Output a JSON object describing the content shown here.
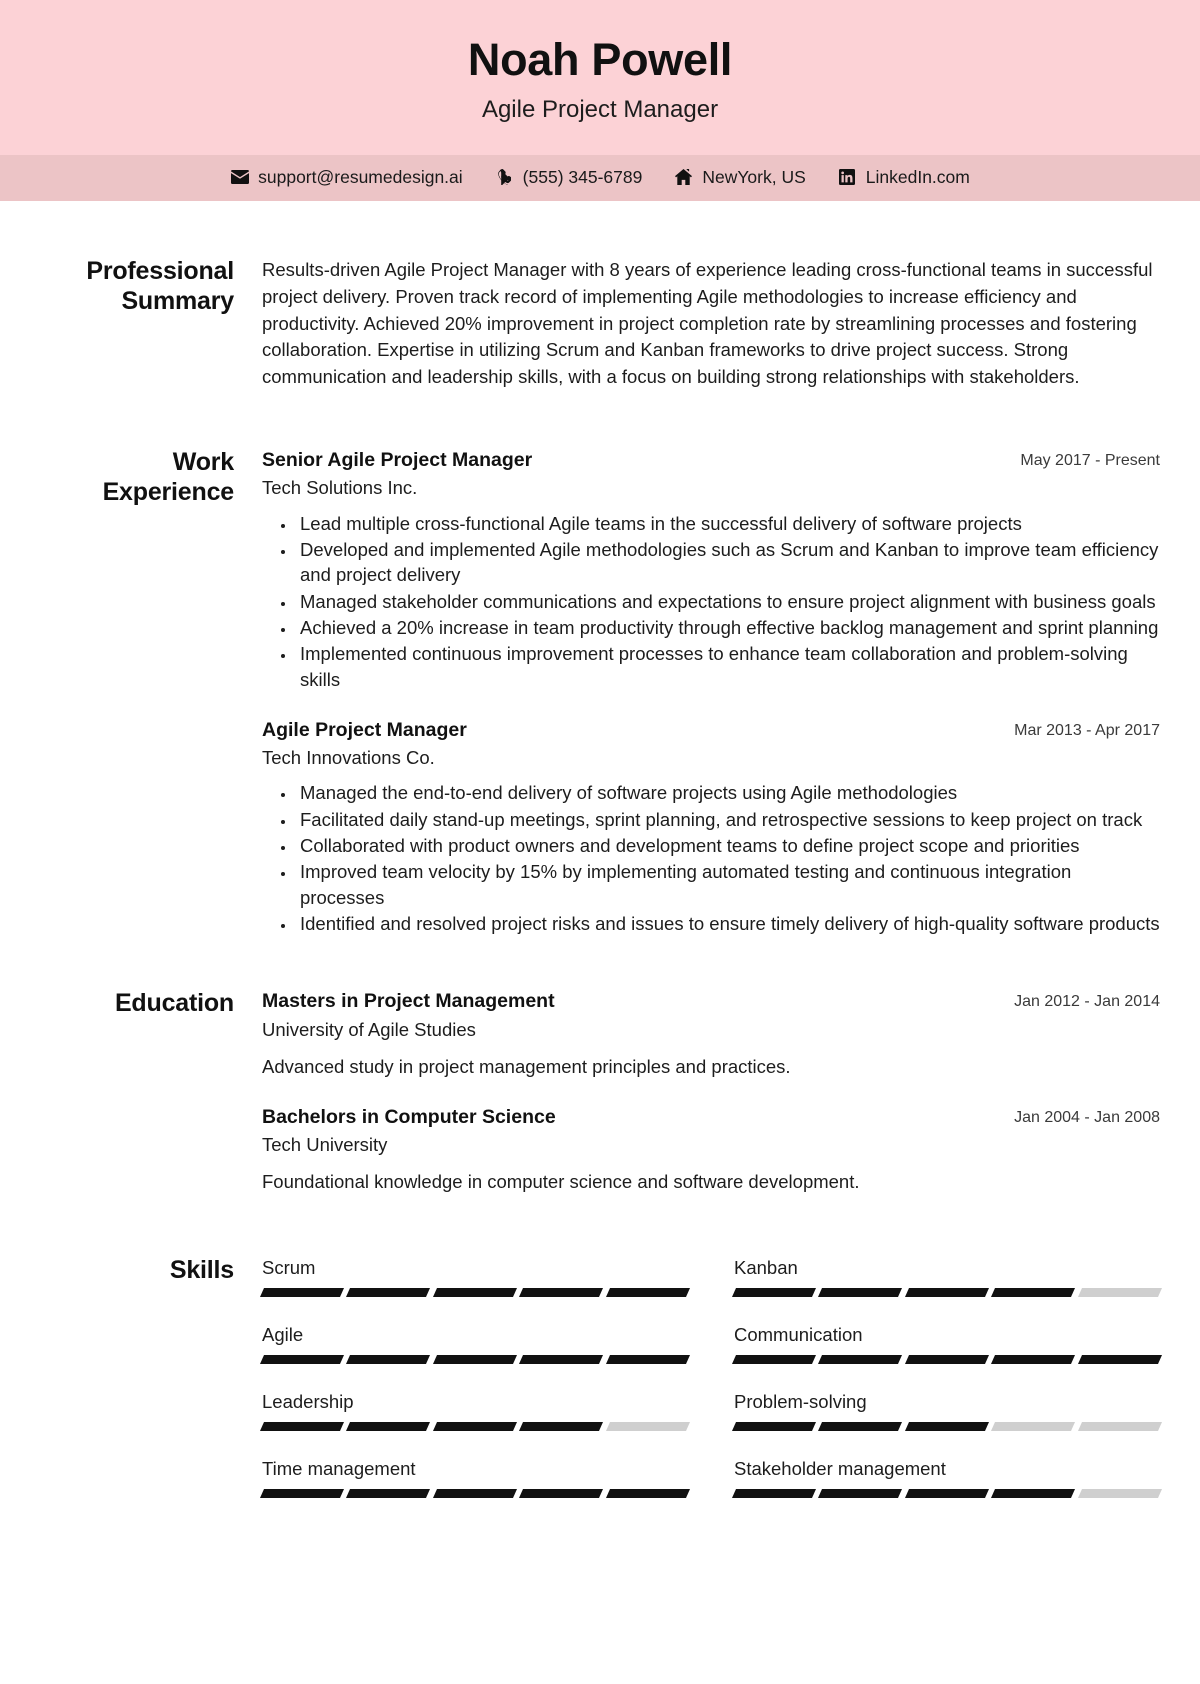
{
  "theme": {
    "header_bg": "#fcd2d6",
    "contact_bg": "#ecc4c6",
    "text": "#1d1d1d",
    "bar_on": "#111111",
    "bar_off": "#cfcfcf"
  },
  "header": {
    "name": "Noah Powell",
    "title": "Agile Project Manager"
  },
  "contact": [
    {
      "icon": "envelope-icon",
      "label": "support@resumedesign.ai"
    },
    {
      "icon": "phone-icon",
      "label": "(555) 345-6789"
    },
    {
      "icon": "home-icon",
      "label": "NewYork, US"
    },
    {
      "icon": "linkedin-icon",
      "label": "LinkedIn.com"
    }
  ],
  "summary": {
    "label": "Professional Summary",
    "text": "Results-driven Agile Project Manager with 8 years of experience leading cross-functional teams in successful project delivery. Proven track record of implementing Agile methodologies to increase efficiency and productivity. Achieved 20% improvement in project completion rate by streamlining processes and fostering collaboration. Expertise in utilizing Scrum and Kanban frameworks to drive project success. Strong communication and leadership skills, with a focus on building strong relationships with stakeholders."
  },
  "work": {
    "label": "Work Experience",
    "entries": [
      {
        "role": "Senior Agile Project Manager",
        "org": "Tech Solutions Inc.",
        "date": "May 2017 - Present",
        "bullets": [
          "Lead multiple cross-functional Agile teams in the successful delivery of software projects",
          "Developed and implemented Agile methodologies such as Scrum and Kanban to improve team efficiency and project delivery",
          "Managed stakeholder communications and expectations to ensure project alignment with business goals",
          "Achieved a 20% increase in team productivity through effective backlog management and sprint planning",
          "Implemented continuous improvement processes to enhance team collaboration and problem-solving skills"
        ]
      },
      {
        "role": "Agile Project Manager",
        "org": "Tech Innovations Co.",
        "date": "Mar 2013 - Apr 2017",
        "bullets": [
          "Managed the end-to-end delivery of software projects using Agile methodologies",
          "Facilitated daily stand-up meetings, sprint planning, and retrospective sessions to keep project on track",
          "Collaborated with product owners and development teams to define project scope and priorities",
          "Improved team velocity by 15% by implementing automated testing and continuous integration processes",
          "Identified and resolved project risks and issues to ensure timely delivery of high-quality software products"
        ]
      }
    ]
  },
  "education": {
    "label": "Education",
    "entries": [
      {
        "degree": "Masters in Project Management",
        "school": "University of Agile Studies",
        "date": "Jan 2012 - Jan 2014",
        "desc": "Advanced study in project management principles and practices."
      },
      {
        "degree": "Bachelors in Computer Science",
        "school": "Tech University",
        "date": "Jan 2004 - Jan 2008",
        "desc": "Foundational knowledge in computer science and software development."
      }
    ]
  },
  "skills": {
    "label": "Skills",
    "total_segments": 5,
    "items": [
      {
        "name": "Scrum",
        "filled": 5
      },
      {
        "name": "Kanban",
        "filled": 4
      },
      {
        "name": "Agile",
        "filled": 5
      },
      {
        "name": "Communication",
        "filled": 5
      },
      {
        "name": "Leadership",
        "filled": 4
      },
      {
        "name": "Problem-solving",
        "filled": 3
      },
      {
        "name": "Time management",
        "filled": 5
      },
      {
        "name": "Stakeholder management",
        "filled": 4
      }
    ]
  }
}
